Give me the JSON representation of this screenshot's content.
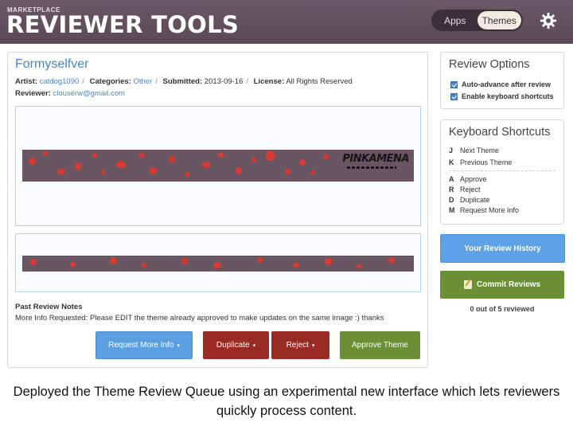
{
  "header": {
    "brand_small": "MARKETPLACE",
    "brand_big": "REVIEWER TOOLS",
    "tabs": [
      {
        "label": "Apps"
      },
      {
        "label": "Themes",
        "active": true
      }
    ],
    "settings_icon": "gear-icon"
  },
  "theme": {
    "title": "Formyselfver",
    "artist_label": "Artist:",
    "artist": "catdog1090",
    "categories_label": "Categories:",
    "category": "Other",
    "submitted_label": "Submitted:",
    "submitted": "2013-09-16",
    "license_label": "License:",
    "license": "All Rights Reserved",
    "reviewer_label": "Reviewer:",
    "reviewer": "clouserw@gmail.com",
    "preview_logo_text": "PINKAMENA"
  },
  "notes": {
    "heading": "Past Review Notes",
    "text": "More Info Requested: Please EDIT the theme already approved to make updates on the same image :) thanks"
  },
  "actions": {
    "request_info": "Request More Info",
    "duplicate": "Duplicate",
    "reject": "Reject",
    "approve": "Approve Theme",
    "caret": "▾"
  },
  "review_options": {
    "heading": "Review Options",
    "options": [
      {
        "label": "Auto-advance after review",
        "checked": true
      },
      {
        "label": "Enable keyboard shortcuts",
        "checked": true
      }
    ]
  },
  "shortcuts": {
    "heading": "Keyboard Shortcuts",
    "nav": [
      {
        "key": "J",
        "label": "Next Theme"
      },
      {
        "key": "K",
        "label": "Previous Theme"
      }
    ],
    "actions": [
      {
        "key": "A",
        "label": "Approve"
      },
      {
        "key": "R",
        "label": "Reject"
      },
      {
        "key": "D",
        "label": "Duplicate"
      },
      {
        "key": "M",
        "label": "Request More Info"
      }
    ]
  },
  "sidebar_buttons": {
    "history": "Your Review History",
    "commit": "Commit Reviews",
    "commit_icon": "pencil-note-icon",
    "count": "0 out of 5 reviewed"
  },
  "colors": {
    "header": "#5b4956",
    "link": "#4c83c2",
    "blue_button": "#5b9fe0",
    "red_button": "#9a2a24",
    "green_button": "#6a8f35"
  },
  "caption": "Deployed the Theme Review Queue using an experimental new interface which lets reviewers quickly process content."
}
